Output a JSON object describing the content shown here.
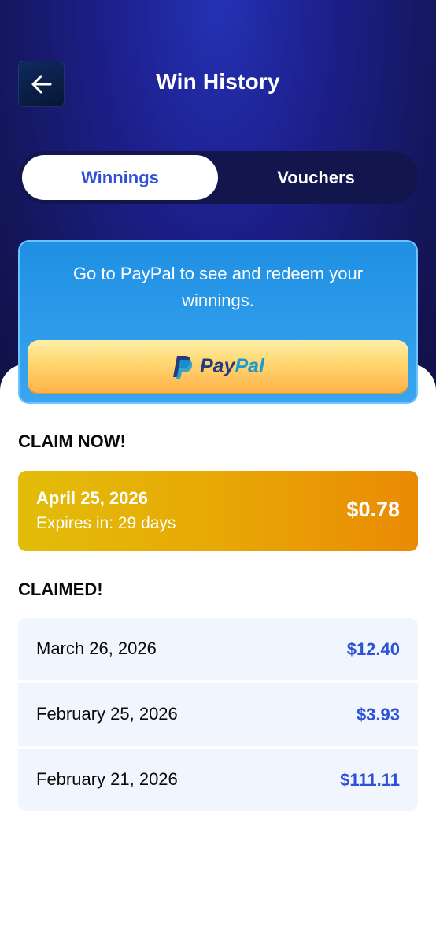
{
  "header": {
    "title": "Win History",
    "back_icon": "arrow-left-icon"
  },
  "tabs": [
    {
      "label": "Winnings",
      "selected": true
    },
    {
      "label": "Vouchers",
      "selected": false
    }
  ],
  "paypal_card": {
    "message": "Go to PayPal to see and redeem your winnings.",
    "button_label_pay": "Pay",
    "button_label_pal": "Pal",
    "logo_icon": "paypal-logo-icon"
  },
  "claim_now": {
    "title": "CLAIM NOW!",
    "item": {
      "date": "April 25, 2026",
      "expiry": "Expires in: 29 days",
      "amount": "$0.78"
    }
  },
  "claimed": {
    "title": "CLAIMED!",
    "items": [
      {
        "date": "March 26, 2026",
        "amount": "$12.40"
      },
      {
        "date": "February 25, 2026",
        "amount": "$3.93"
      },
      {
        "date": "February 21, 2026",
        "amount": "$111.11"
      }
    ]
  },
  "colors": {
    "accent_blue": "#2f51d6",
    "header_navy": "#1d1f8c",
    "claim_gold": "#e8a806"
  }
}
